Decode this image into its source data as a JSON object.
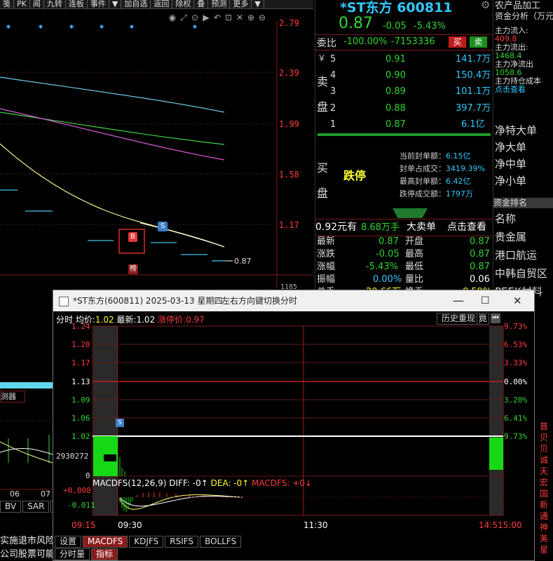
{
  "toolbar": {
    "items": [
      "笺",
      "PK",
      "闻",
      "九转",
      "连板",
      "事件",
      "▼",
      "加自选",
      "返回",
      "除权",
      "叠",
      "预测",
      "更多",
      "▼"
    ],
    "icons": [
      "eye-icon",
      "expand-icon",
      "reset-icon",
      "play-icon",
      "undo-icon",
      "crop-icon",
      "cross-icon",
      "zoom-in-icon",
      "zoom-out-icon"
    ]
  },
  "main_chart": {
    "price_labels": [
      "2.79",
      "2.39",
      "1.99",
      "1.58",
      "1.17"
    ],
    "last_price_tag": "0.87",
    "marker_b": "B",
    "marker_s": "S",
    "bang": "榜",
    "cut_value": "1185",
    "tabs_bottom": [
      "BV",
      "SAR",
      "E"
    ],
    "x_labels": [
      "06",
      "07"
    ],
    "predict_label": "测器",
    "news": [
      "实施退市风险",
      "公司股票可能"
    ]
  },
  "quote": {
    "name": "*ST东方 600811",
    "price": "0.87",
    "change": "-0.05",
    "change_pct": "-5.43%",
    "weibi_label": "委比",
    "weibi_value": "-100.00%",
    "weicha": "-7153336",
    "buy_btn": "买",
    "sell_btn": "卖",
    "sell_side_label": [
      "卖",
      "盘"
    ],
    "asks": [
      {
        "lvl": "5",
        "price": "0.91",
        "vol": "141.7万"
      },
      {
        "lvl": "4",
        "price": "0.90",
        "vol": "150.4万"
      },
      {
        "lvl": "3",
        "price": "0.89",
        "vol": "101.1万"
      },
      {
        "lvl": "2",
        "price": "0.88",
        "vol": "397.7万"
      },
      {
        "lvl": "1",
        "price": "0.87",
        "vol": "6.1亿"
      }
    ],
    "yen": "￥",
    "buy_side_label": [
      "买",
      "盘"
    ],
    "limit_down": "跌停",
    "seal": [
      {
        "k": "当前封单额：",
        "v": "6.15亿"
      },
      {
        "k": "封单占成交：",
        "v": "3419.39%"
      },
      {
        "k": "最高封单额：",
        "v": "6.42亿"
      },
      {
        "k": "跌停成交额：",
        "v": "1797万"
      }
    ],
    "big_order_line": {
      "a": "0.92元有",
      "b": "8.68万手",
      "c": "大卖单",
      "d": "点击查看"
    },
    "stats": [
      {
        "l1": "最新",
        "v1": "0.87",
        "l2": "开盘",
        "v2": "0.87"
      },
      {
        "l1": "涨跌",
        "v1": "-0.05",
        "l2": "最高",
        "v2": "0.87"
      },
      {
        "l1": "涨幅",
        "v1": "-5.43%",
        "l2": "最低",
        "v2": "0.87"
      },
      {
        "l1": "振幅",
        "v1": "0.00%",
        "l2": "量比",
        "v2": "0.06"
      },
      {
        "l1": "总手",
        "v1": "20.66万",
        "l2": "换手",
        "v2": "0.59%"
      }
    ]
  },
  "right_panel": {
    "industry": "农产品加工",
    "fund_title": "资金分析（万元",
    "flows": [
      {
        "k": "主力流入:",
        "v": "409.8"
      },
      {
        "k": "主力流出:",
        "v": "1468.4"
      },
      {
        "k": "主力净流出",
        "v": "1058.6"
      },
      {
        "k": "主力持仓成本",
        "v": "点击查看"
      }
    ],
    "orders": [
      "净特大单",
      "净大单",
      "净中单",
      "净小单"
    ],
    "rank_title": "资金排名",
    "rank_head": "名称",
    "ranks": [
      "贵金属",
      "港口航运",
      "中韩自贸区",
      "PEEK材料"
    ],
    "lower": [
      "普",
      "贝",
      "贝",
      "诚",
      "天",
      "宏",
      "国",
      "新",
      "通",
      "神",
      "美",
      "星"
    ]
  },
  "window": {
    "title": "*ST东方(600811) 2025-03-13 星期四",
    "hint": "左右方向键切换分时",
    "header": {
      "label": "分时",
      "avg_label": "均价:",
      "avg": "1.02",
      "last_label": "最新:",
      "last": "1.02",
      "limit_label": "涨停价:",
      "limit": "0.97"
    },
    "history_btn": "历史重现",
    "small_btn": "竟",
    "y_left": [
      "1.24",
      "1.20",
      "1.17",
      "1.13",
      "1.09",
      "1.06",
      "1.02",
      "2930272",
      "0"
    ],
    "y_right": [
      "9.73%",
      "6.53%",
      "3.33%",
      "0.00%",
      "3.20%",
      "6.41%",
      "9.73%"
    ],
    "macd_label": "MACDFS(12,26,9)",
    "diff": "DIFF: -0↑",
    "dea": "DEA: -0↑",
    "macdfs": "MACDFS: +0↓",
    "macd_y": [
      "+0.008",
      "-0.011"
    ],
    "x_labels": [
      "09:15",
      "09:30",
      "11:30",
      "14:5",
      "15:00"
    ],
    "settings": "设置",
    "tabs": [
      "MACDFS",
      "KDJFS",
      "RSIFS",
      "BOLLFS"
    ],
    "bottom_tabs": [
      "分时量",
      "指标"
    ],
    "marker_s": "S"
  },
  "colors": {
    "up": "#ff3c3c",
    "down": "#2fd52f",
    "accent": "#ffff33",
    "info": "#33c9ff"
  }
}
